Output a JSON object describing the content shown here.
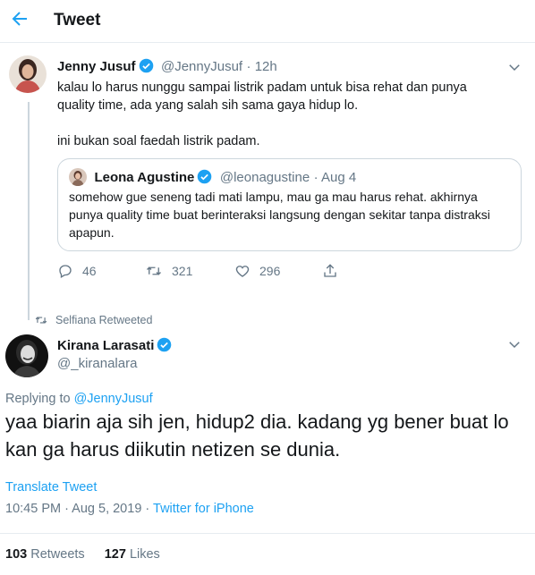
{
  "header": {
    "title": "Tweet"
  },
  "tweet": {
    "author": {
      "name": "Jenny Jusuf",
      "handle": "@JennyJusuf",
      "time": "12h"
    },
    "paragraphs": [
      "kalau lo harus nunggu sampai listrik padam untuk bisa rehat dan punya quality time, ada yang salah sih sama gaya hidup lo.",
      "ini bukan soal faedah listrik padam."
    ],
    "quote": {
      "name": "Leona Agustine",
      "handle": "@leonagustine",
      "date": "Aug 4",
      "text": "somehow gue seneng tadi mati lampu, mau ga mau harus rehat. akhirnya punya quality time buat berinteraksi langsung dengan sekitar tanpa distraksi apapun."
    },
    "actions": {
      "replies": "46",
      "retweets": "321",
      "likes": "296"
    }
  },
  "retweeted_by": "Selfiana Retweeted",
  "reply": {
    "author": {
      "name": "Kirana Larasati",
      "handle": "@_kiranalara"
    },
    "replying_prefix": "Replying to ",
    "replying_to": "@JennyJusuf",
    "text": "yaa biarin aja sih jen, hidup2 dia. kadang yg bener buat lo kan ga harus diikutin netizen se dunia.",
    "translate": "Translate Tweet",
    "time": "10:45 PM",
    "date": "Aug 5, 2019",
    "source": "Twitter for iPhone",
    "retweets_count": "103",
    "retweets_label": "Retweets",
    "likes_count": "127",
    "likes_label": "Likes"
  },
  "colors": {
    "accent": "#1da1f2",
    "muted": "#657786",
    "border": "#e6ecf0"
  }
}
